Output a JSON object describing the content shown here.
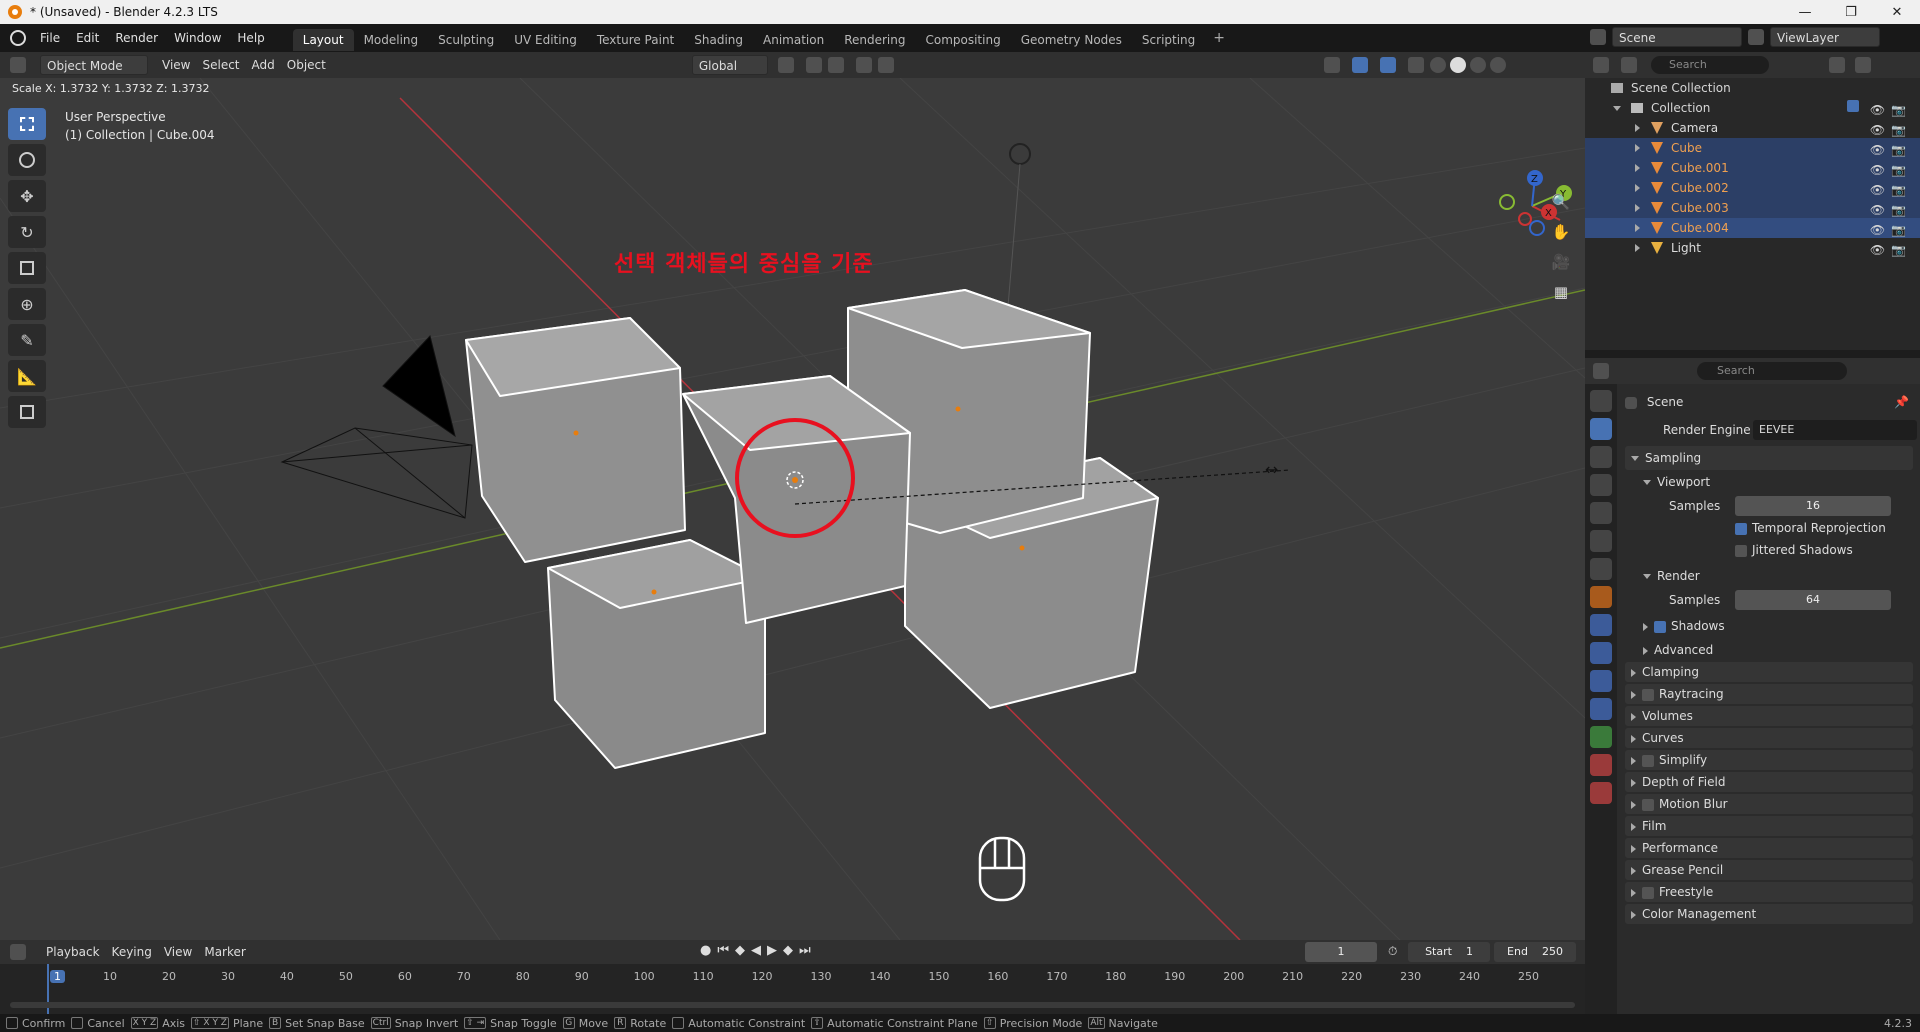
{
  "window": {
    "title": "* (Unsaved) - Blender 4.2.3 LTS"
  },
  "menu": [
    "File",
    "Edit",
    "Render",
    "Window",
    "Help"
  ],
  "workspaces": [
    "Layout",
    "Modeling",
    "Sculpting",
    "UV Editing",
    "Texture Paint",
    "Shading",
    "Animation",
    "Rendering",
    "Compositing",
    "Geometry Nodes",
    "Scripting"
  ],
  "active_workspace": "Layout",
  "scene": {
    "name": "Scene",
    "viewlayer": "ViewLayer"
  },
  "viewport_header": {
    "mode": "Object Mode",
    "view": "View",
    "select": "Select",
    "add": "Add",
    "object": "Object",
    "orientation": "Global"
  },
  "viewport": {
    "scale_readout": "Scale X: 1.3732   Y: 1.3732   Z: 1.3732",
    "perspective": "User Perspective",
    "collection_info": "(1) Collection | Cube.004",
    "annotation": "선택 객체들의 중심을 기준",
    "gizmo_axes": [
      "X",
      "Y",
      "Z"
    ]
  },
  "outliner": {
    "search_placeholder": "Search",
    "root": "Scene Collection",
    "collection": "Collection",
    "items": [
      {
        "name": "Camera",
        "type": "camera",
        "selected": false
      },
      {
        "name": "Cube",
        "type": "mesh",
        "selected": true
      },
      {
        "name": "Cube.001",
        "type": "mesh",
        "selected": true
      },
      {
        "name": "Cube.002",
        "type": "mesh",
        "selected": true
      },
      {
        "name": "Cube.003",
        "type": "mesh",
        "selected": true
      },
      {
        "name": "Cube.004",
        "type": "mesh",
        "selected": true,
        "active": true
      },
      {
        "name": "Light",
        "type": "light",
        "selected": false
      }
    ]
  },
  "properties": {
    "search_placeholder": "Search",
    "context": "Scene",
    "render_engine_label": "Render Engine",
    "render_engine": "EEVEE",
    "sampling": "Sampling",
    "viewport": "Viewport",
    "samples_label": "Samples",
    "viewport_samples": "16",
    "temporal_reprojection": "Temporal Reprojection",
    "jittered_shadows": "Jittered Shadows",
    "render": "Render",
    "render_samples": "64",
    "shadows": "Shadows",
    "advanced": "Advanced",
    "sections": [
      "Clamping",
      "Raytracing",
      "Volumes",
      "Curves",
      "Simplify",
      "Depth of Field",
      "Motion Blur",
      "Film",
      "Performance",
      "Grease Pencil",
      "Freestyle",
      "Color Management"
    ]
  },
  "timeline": {
    "playback": "Playback",
    "keying": "Keying",
    "view": "View",
    "marker": "Marker",
    "current_frame": "1",
    "start_label": "Start",
    "start": "1",
    "end_label": "End",
    "end": "250",
    "ticks": [
      "1",
      "10",
      "20",
      "30",
      "40",
      "50",
      "60",
      "70",
      "80",
      "90",
      "100",
      "110",
      "120",
      "130",
      "140",
      "150",
      "160",
      "170",
      "180",
      "190",
      "200",
      "210",
      "220",
      "230",
      "240",
      "250"
    ]
  },
  "statusbar": [
    {
      "key": "",
      "label": "Confirm"
    },
    {
      "key": "",
      "label": "Cancel"
    },
    {
      "key": "X Y Z",
      "label": "Axis"
    },
    {
      "key": "⇧ X Y Z",
      "label": "Plane"
    },
    {
      "key": "B",
      "label": "Set Snap Base"
    },
    {
      "key": "Ctrl",
      "label": "Snap Invert"
    },
    {
      "key": "⇧ ⇥",
      "label": "Snap Toggle"
    },
    {
      "key": "G",
      "label": "Move"
    },
    {
      "key": "R",
      "label": "Rotate"
    },
    {
      "key": "",
      "label": "Automatic Constraint"
    },
    {
      "key": "⇧",
      "label": "Automatic Constraint Plane"
    },
    {
      "key": "⇧",
      "label": "Precision Mode"
    },
    {
      "key": "Alt",
      "label": "Navigate"
    }
  ],
  "version": "4.2.3",
  "colors": {
    "accent": "#4772b3",
    "annotation": "#e8101f",
    "selected_outline": "#ffffff",
    "origin": "#e87d0d"
  }
}
